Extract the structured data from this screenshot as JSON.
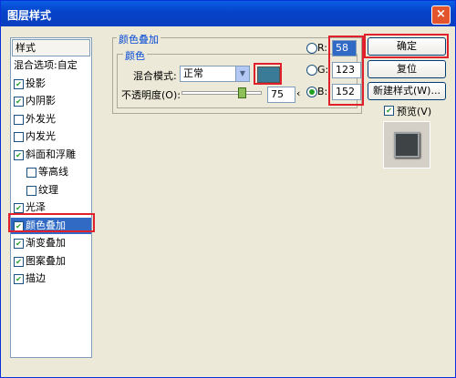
{
  "window": {
    "title": "图层样式",
    "close": "×"
  },
  "styles_panel": {
    "header": "样式",
    "items": [
      {
        "label": "混合选项:自定",
        "checkbox": false,
        "checked": false,
        "indent": 0
      },
      {
        "label": "投影",
        "checkbox": true,
        "checked": true,
        "indent": 0
      },
      {
        "label": "内阴影",
        "checkbox": true,
        "checked": true,
        "indent": 0
      },
      {
        "label": "外发光",
        "checkbox": true,
        "checked": false,
        "indent": 0
      },
      {
        "label": "内发光",
        "checkbox": true,
        "checked": false,
        "indent": 0
      },
      {
        "label": "斜面和浮雕",
        "checkbox": true,
        "checked": true,
        "indent": 0
      },
      {
        "label": "等高线",
        "checkbox": true,
        "checked": false,
        "indent": 1
      },
      {
        "label": "纹理",
        "checkbox": true,
        "checked": false,
        "indent": 1
      },
      {
        "label": "光泽",
        "checkbox": true,
        "checked": true,
        "indent": 0
      },
      {
        "label": "颜色叠加",
        "checkbox": true,
        "checked": true,
        "indent": 0,
        "selected": true
      },
      {
        "label": "渐变叠加",
        "checkbox": true,
        "checked": true,
        "indent": 0
      },
      {
        "label": "图案叠加",
        "checkbox": true,
        "checked": true,
        "indent": 0
      },
      {
        "label": "描边",
        "checkbox": true,
        "checked": true,
        "indent": 0
      }
    ]
  },
  "color_overlay": {
    "group_title": "颜色叠加",
    "subgroup_title": "颜色",
    "blend_mode_label": "混合模式:",
    "blend_mode_value": "正常",
    "opacity_label": "不透明度(O):",
    "opacity_value": "75",
    "opacity_fraction": 0.75,
    "color_swatch": "#3a7b98"
  },
  "rgb": {
    "r_label": "R:",
    "r_value": "58",
    "g_label": "G:",
    "g_value": "123",
    "b_label": "B:",
    "b_value": "152"
  },
  "actions": {
    "ok": "确定",
    "reset": "复位",
    "new_style": "新建样式(W)...",
    "preview_label": "预览(V)",
    "preview_checked": true
  },
  "colors": {
    "highlight": "#e0202a",
    "selection": "#316ac5",
    "title_bar": "#0542c8"
  }
}
